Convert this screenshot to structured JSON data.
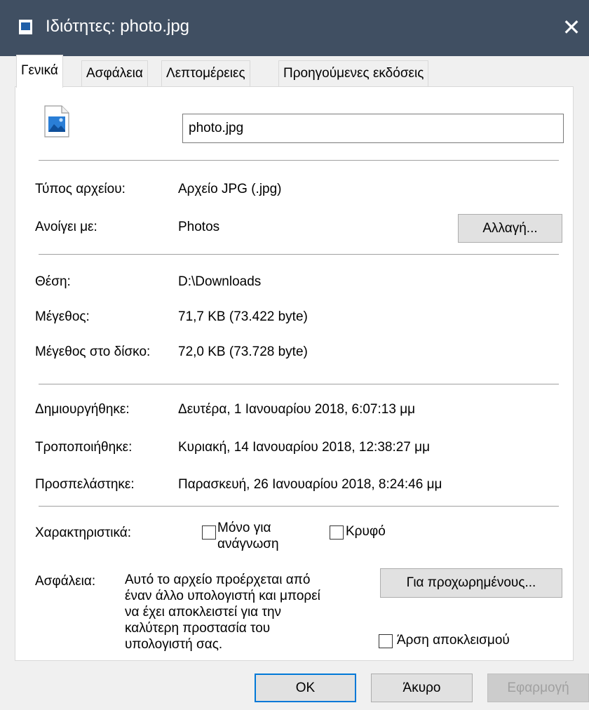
{
  "window": {
    "title": "Ιδιότητες: photo.jpg",
    "close_glyph": "✕",
    "title_bar_color": "#404f62"
  },
  "tabs": [
    {
      "label": "Γενικά",
      "active": true
    },
    {
      "label": "Ασφάλεια",
      "active": false
    },
    {
      "label": "Λεπτομέρειες",
      "active": false
    },
    {
      "label": "Προηγούμενες εκδόσεις",
      "active": false
    }
  ],
  "general": {
    "file_name": "photo.jpg",
    "file_type_label": "Τύπος αρχείου:",
    "file_type_value": "Αρχείο JPG (.jpg)",
    "opens_with_label": "Ανοίγει με:",
    "opens_with_value": "Photos",
    "change_button": "Αλλαγή...",
    "location_label": "Θέση:",
    "location_value": "D:\\Downloads",
    "size_label": "Μέγεθος:",
    "size_value": "71,7 KB (73.422 byte)",
    "size_on_disk_label": "Μέγεθος στο δίσκο:",
    "size_on_disk_value": "72,0 KB (73.728 byte)",
    "created_label": "Δημιουργήθηκε:",
    "created_value": "Δευτέρα, 1 Ιανουαρίου 2018, 6:07:13 μμ",
    "modified_label": "Τροποποιήθηκε:",
    "modified_value": "Κυριακή, 14 Ιανουαρίου 2018, 12:38:27 μμ",
    "accessed_label": "Προσπελάστηκε:",
    "accessed_value": "Παρασκευή, 26 Ιανουαρίου 2018, 8:24:46 μμ",
    "attributes_label": "Χαρακτηριστικά:",
    "readonly_line1": "Μόνο για",
    "readonly_line2": "ανάγνωση",
    "readonly_checked": false,
    "hidden_label": "Κρυφό",
    "hidden_checked": false,
    "advanced_button": "Για προχωρημένους...",
    "security_label": "Ασφάλεια:",
    "security_lines": [
      "Αυτό το αρχείο προέρχεται από",
      "έναν άλλο υπολογιστή και μπορεί",
      "να έχει αποκλειστεί για την",
      "καλύτερη προστασία του",
      "υπολογιστή σας."
    ],
    "unblock_label": "Άρση αποκλεισμού",
    "unblock_checked": false
  },
  "footer": {
    "ok": "OK",
    "cancel": "Άκυρο",
    "apply": "Εφαρμογή"
  },
  "icons": {
    "title_icon": "file-properties-icon",
    "file_icon": "image-file-icon"
  }
}
